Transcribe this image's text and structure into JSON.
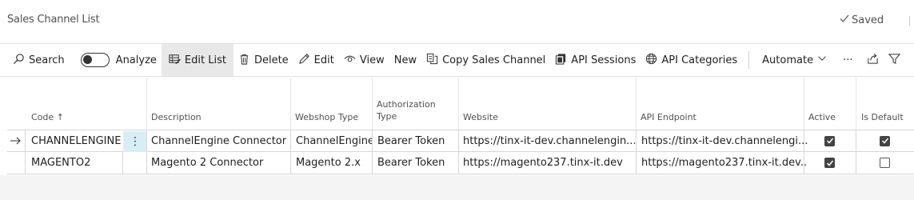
{
  "page": {
    "title": "Sales Channel List",
    "saved_label": "Saved"
  },
  "toolbar": {
    "search": "Search",
    "analyze": "Analyze",
    "edit_list": "Edit List",
    "delete": "Delete",
    "edit": "Edit",
    "view": "View",
    "new": "New",
    "copy_sales_channel": "Copy Sales Channel",
    "api_sessions": "API Sessions",
    "api_categories": "API Categories",
    "automate": "Automate",
    "more": "···"
  },
  "table": {
    "columns": {
      "code": "Code ↑",
      "description": "Description",
      "webshop_type": "Webshop Type",
      "authorization_type_1": "Authorization",
      "authorization_type_2": "Type",
      "website": "Website",
      "api_endpoint": "API Endpoint",
      "active": "Active",
      "is_default": "Is Default"
    },
    "rows": [
      {
        "code": "CHANNELENGINE",
        "description": "ChannelEngine Connector",
        "webshop_type": "ChannelEngine",
        "authorization_type": "Bearer Token",
        "website": "https://tinx-it-dev.channelengin...",
        "api_endpoint": "https://tinx-it-dev.channelengi...",
        "active": true,
        "is_default": true
      },
      {
        "code": "MAGENTO2",
        "description": "Magento 2 Connector",
        "webshop_type": "Magento 2.x",
        "authorization_type": "Bearer Token",
        "website": "https://magento237.tinx-it.dev",
        "api_endpoint": "https://magento237.tinx-it.dev...",
        "active": true,
        "is_default": false
      }
    ]
  }
}
